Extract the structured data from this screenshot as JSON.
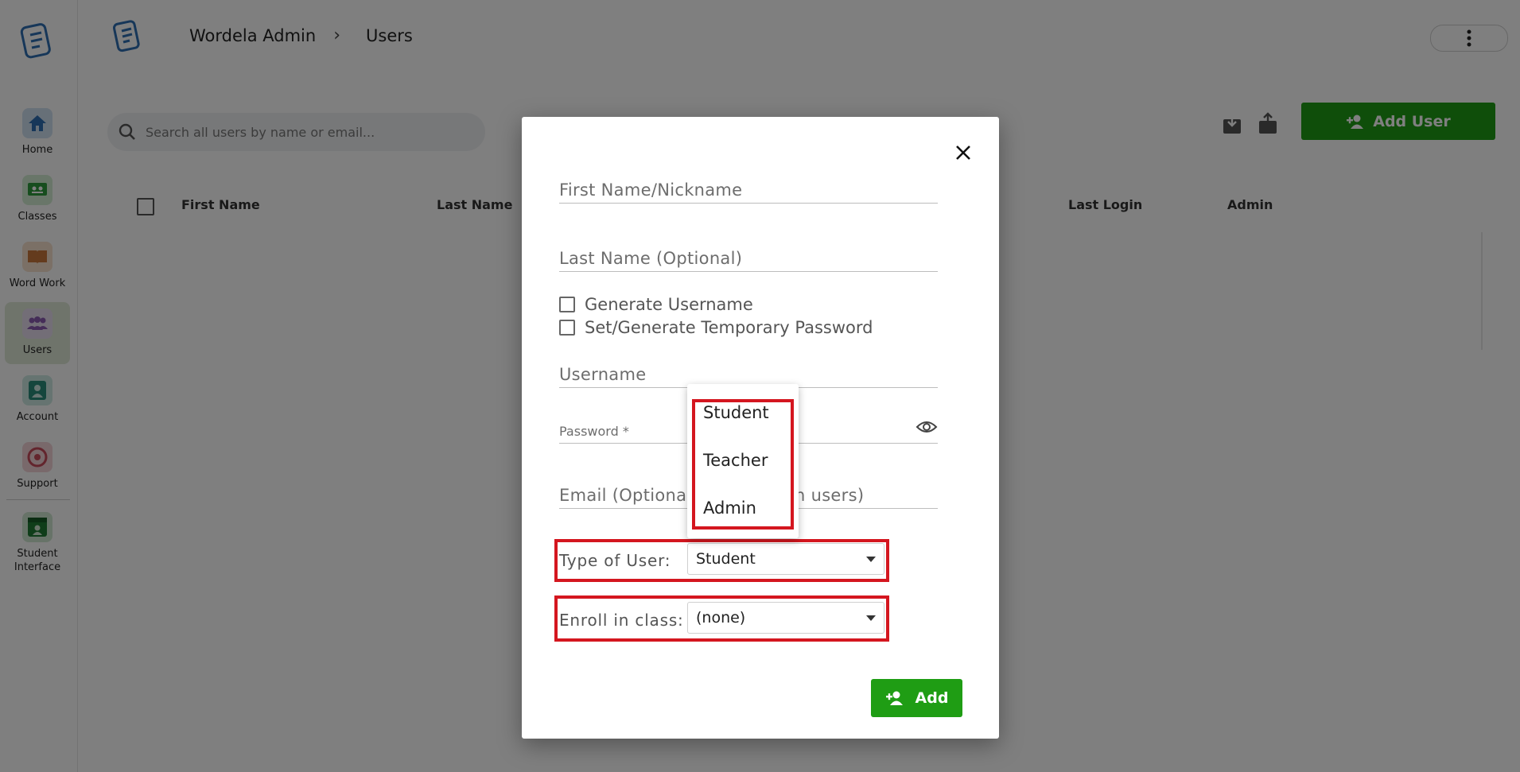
{
  "sidebar": {
    "items": [
      {
        "label": "Home",
        "icon": "home-icon",
        "color": "#2f6fb3"
      },
      {
        "label": "Classes",
        "icon": "classes-icon",
        "color": "#2e9a3d"
      },
      {
        "label": "Word Work",
        "icon": "book-icon",
        "color": "#c9773a"
      },
      {
        "label": "Users",
        "icon": "users-icon",
        "color": "#8a5bb0"
      },
      {
        "label": "Account",
        "icon": "account-icon",
        "color": "#2a8d7a"
      },
      {
        "label": "Support",
        "icon": "support-icon",
        "color": "#c74a5a"
      },
      {
        "label": "Student Interface",
        "icon": "student-interface-icon",
        "color": "#1f7a33"
      }
    ]
  },
  "header": {
    "breadcrumb_root": "Wordela Admin",
    "breadcrumb_current": "Users"
  },
  "toolbar": {
    "search_placeholder": "Search all users by name or email...",
    "add_user_label": "Add User"
  },
  "table": {
    "columns": [
      "First Name",
      "Last Name",
      "Last Login",
      "Admin"
    ]
  },
  "modal": {
    "first_name_label": "First Name/Nickname",
    "last_name_label": "Last Name (Optional)",
    "generate_username_label": "Generate Username",
    "temp_password_label": "Set/Generate Temporary Password",
    "username_label": "Username",
    "password_label": "Password *",
    "email_label_left": "Email (Optional",
    "email_label_right": "n users)",
    "type_of_user_label": "Type of User:",
    "type_of_user_value": "Student",
    "enroll_label": "Enroll in class:",
    "enroll_value": "(none)",
    "add_label": "Add"
  },
  "user_type_menu": {
    "options": [
      "Student",
      "Teacher",
      "Admin"
    ]
  },
  "colors": {
    "accent_green": "#1f9d14",
    "highlight_red": "#d4161f"
  }
}
